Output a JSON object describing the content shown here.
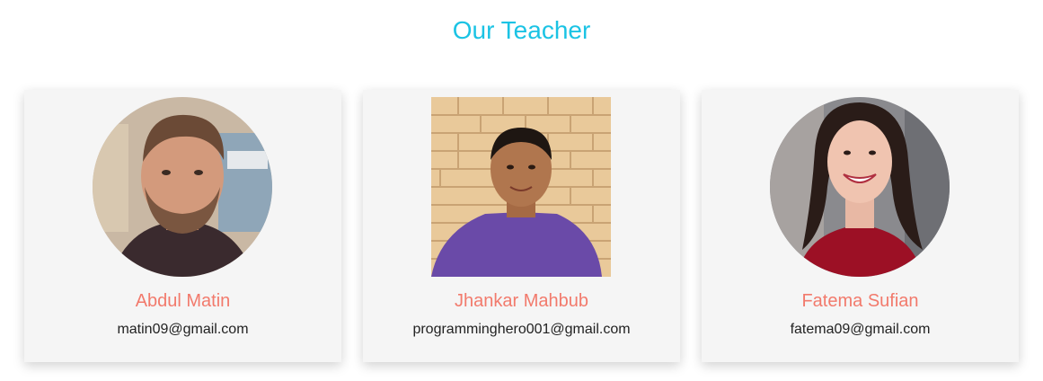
{
  "section": {
    "title": "Our Teacher"
  },
  "colors": {
    "title": "#1bc3e4",
    "name": "#f27a6c",
    "card_bg": "#f5f5f5"
  },
  "teachers": [
    {
      "name": "Abdul Matin",
      "email": "matin09@gmail.com",
      "photo_shape": "circle"
    },
    {
      "name": "Jhankar Mahbub",
      "email": "programminghero001@gmail.com",
      "photo_shape": "square"
    },
    {
      "name": "Fatema Sufian",
      "email": "fatema09@gmail.com",
      "photo_shape": "circle"
    }
  ]
}
